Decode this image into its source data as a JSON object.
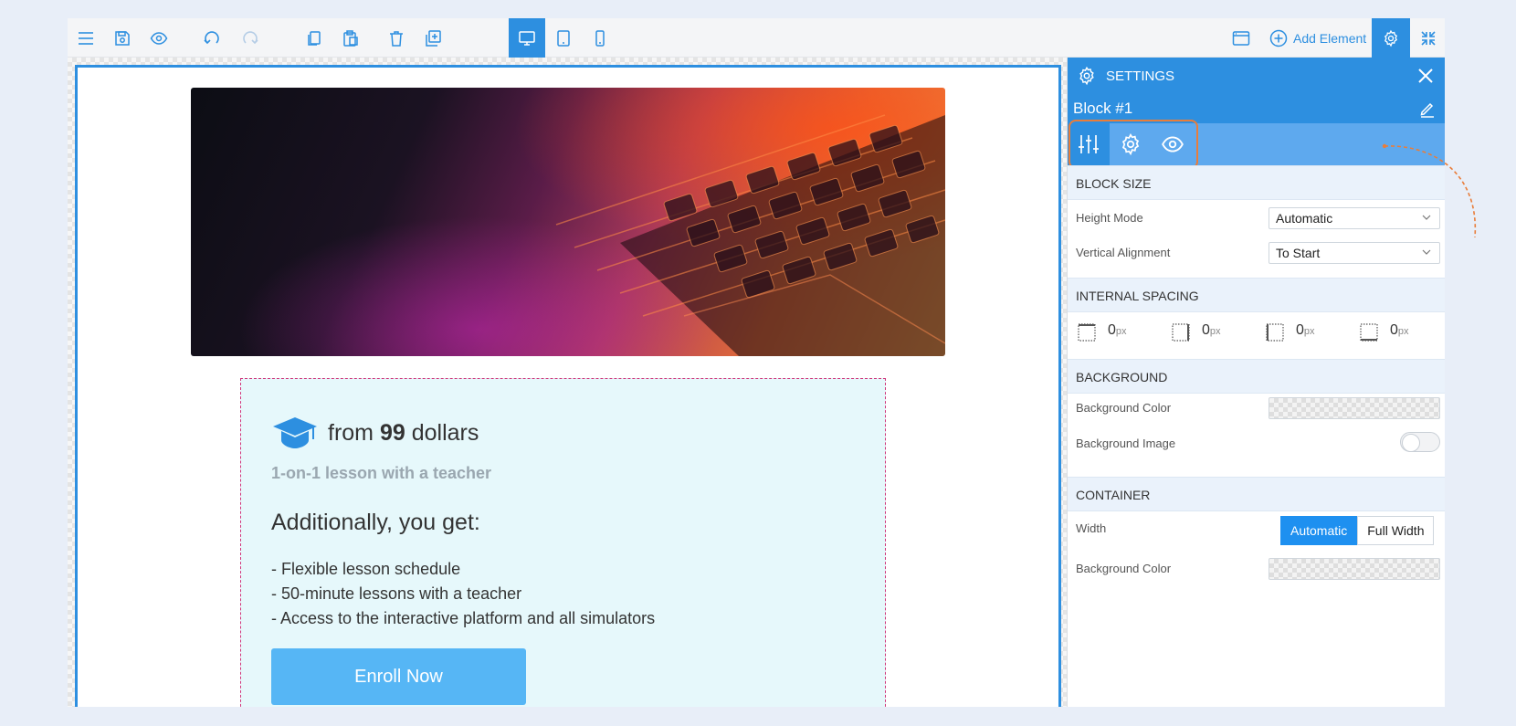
{
  "toolbar": {
    "left_icons": [
      "menu-icon",
      "save-icon",
      "preview-icon",
      "undo-icon",
      "redo-icon",
      "copy-icon",
      "paste-icon",
      "delete-icon",
      "duplicate-icon"
    ],
    "device_icons": [
      "desktop-icon",
      "tablet-icon",
      "mobile-icon"
    ],
    "active_device": "desktop",
    "add_element_label": "Add Element",
    "accent": "#2d8fe0"
  },
  "content": {
    "price_prefix": "from ",
    "price_amount": "99",
    "price_suffix": " dollars",
    "subtitle": "1-on-1 lesson with a teacher",
    "additional_heading": "Additionally, you get:",
    "features": [
      "- Flexible lesson schedule",
      "- 50-minute lessons with a teacher",
      "- Access to the interactive platform and all simulators"
    ],
    "cta_label": "Enroll Now"
  },
  "settings": {
    "title": "SETTINGS",
    "block_name": "Block #1",
    "tabs": [
      "sliders-icon",
      "gear-icon",
      "eye-icon"
    ],
    "sections": {
      "block_size": {
        "title": "BLOCK SIZE",
        "height_mode_label": "Height Mode",
        "height_mode_value": "Automatic",
        "vertical_alignment_label": "Vertical Alignment",
        "vertical_alignment_value": "To Start"
      },
      "internal_spacing": {
        "title": "INTERNAL SPACING",
        "values": [
          "0",
          "0",
          "0",
          "0"
        ],
        "unit": "px"
      },
      "background": {
        "title": "BACKGROUND",
        "color_label": "Background Color",
        "image_label": "Background Image",
        "image_enabled": false
      },
      "container": {
        "title": "CONTAINER",
        "width_label": "Width",
        "width_options": [
          "Automatic",
          "Full Width"
        ],
        "width_selected": "Automatic",
        "color_label": "Background Color"
      }
    }
  }
}
